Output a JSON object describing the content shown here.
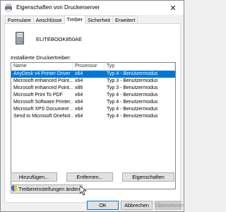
{
  "window": {
    "title": "Eigenschaften von Druckerserver",
    "close_glyph": "✕"
  },
  "tabs": [
    {
      "label": "Formulare"
    },
    {
      "label": "Anschlüsse"
    },
    {
      "label": "Treiber",
      "active": true
    },
    {
      "label": "Sicherheit"
    },
    {
      "label": "Erweitert"
    }
  ],
  "server": {
    "name": "ELITEBOOK850AE",
    "icon": "server-icon"
  },
  "drivers": {
    "label": "Installierte Druckertreiber:",
    "columns": {
      "name": "Name",
      "processor": "Prozessor",
      "type": "Typ"
    },
    "rows": [
      {
        "name": "AnyDesk v4 Printer Driver",
        "processor": "x64",
        "type": "Typ 4 - Benutzermodus",
        "selected": true
      },
      {
        "name": "Microsoft enhanced Point...",
        "processor": "x64",
        "type": "Typ 3 - Benutzermodus"
      },
      {
        "name": "Microsoft enhanced Point...",
        "processor": "x86",
        "type": "Typ 3 - Benutzermodus"
      },
      {
        "name": "Microsoft Print To PDF",
        "processor": "x64",
        "type": "Typ 4 - Benutzermodus"
      },
      {
        "name": "Microsoft Software Printer...",
        "processor": "x64",
        "type": "Typ 4 - Benutzermodus"
      },
      {
        "name": "Microsoft XPS Document ...",
        "processor": "x64",
        "type": "Typ 4 - Benutzermodus"
      },
      {
        "name": "Send to Microsoft OneNot...",
        "processor": "x64",
        "type": "Typ 4 - Benutzermodus"
      }
    ]
  },
  "buttons": {
    "add": "Hinzufügen...",
    "remove": "Entfernen...",
    "properties": "Eigenschaften",
    "change_settings": "Treibereinstellungen ändern",
    "ok": "OK",
    "cancel": "Abbrechen",
    "apply": "Übernehmen"
  },
  "colors": {
    "selection": "#0078d7",
    "accent_border": "#0078d7"
  }
}
